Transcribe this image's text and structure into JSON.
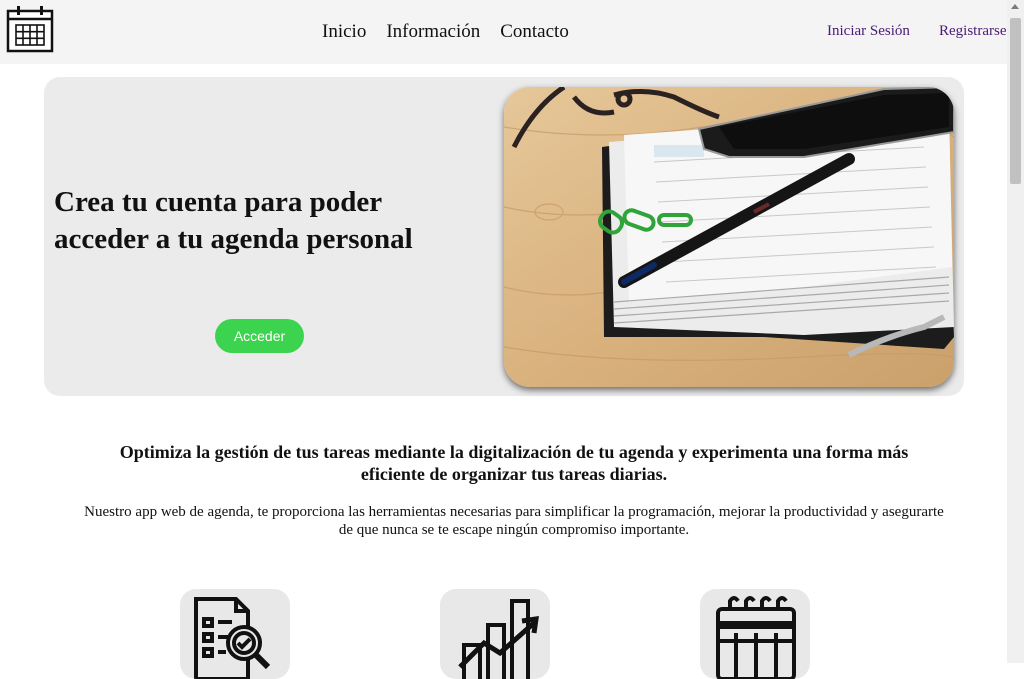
{
  "header": {
    "logo_icon": "calendar-icon",
    "nav": [
      "Inicio",
      "Información",
      "Contacto"
    ],
    "login_label": "Iniciar Sesión",
    "register_label": "Registrarse"
  },
  "hero": {
    "title": "Crea tu cuenta para poder acceder a tu agenda personal",
    "button_label": "Acceder",
    "button_color": "#3cd44f",
    "image_icon": "agenda-photo"
  },
  "intro": {
    "heading": "Optimiza la gestión de tus tareas mediante la digitalización de tu agenda y experimenta una forma más eficiente de organizar tus tareas diarias.",
    "text": "Nuestro app web de agenda, te proporciona las herramientas necesarias para simplificar la programación, mejorar la productividad y asegurarte de que nunca se te escape ningún compromiso importante."
  },
  "features": [
    {
      "icon": "checklist-icon"
    },
    {
      "icon": "growth-chart-icon"
    },
    {
      "icon": "calendar-icon"
    }
  ]
}
